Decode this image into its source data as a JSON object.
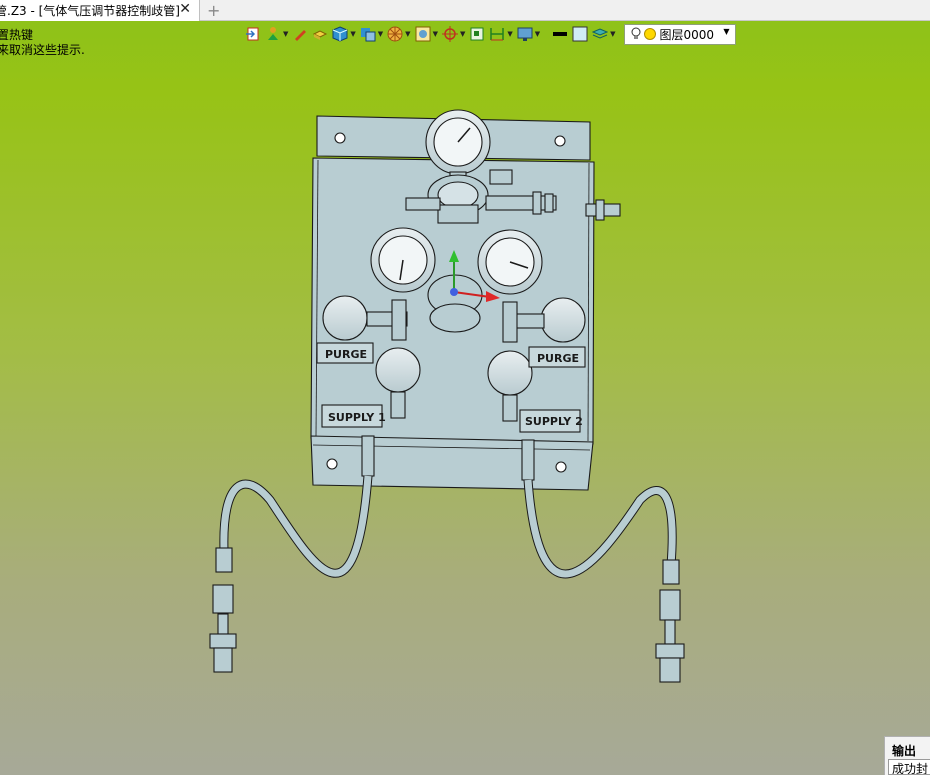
{
  "tab": {
    "title": "管.Z3 - [气体气压调节器控制歧管]",
    "close_glyph": "✕",
    "add_glyph": "+"
  },
  "hints": {
    "line1": "置热键",
    "line2": "来取消这些提示."
  },
  "toolbar": {
    "buttons": [
      {
        "icon": "import-icon",
        "dropdown": false
      },
      {
        "icon": "layer-person-icon",
        "dropdown": true
      },
      {
        "icon": "pen-icon",
        "dropdown": false
      },
      {
        "icon": "box-pencil-icon",
        "dropdown": false
      },
      {
        "icon": "cube-icon",
        "dropdown": true
      },
      {
        "icon": "copy-icon",
        "dropdown": true
      },
      {
        "icon": "view-wheel-icon",
        "dropdown": true
      },
      {
        "icon": "frame-icon",
        "dropdown": true
      },
      {
        "icon": "target-icon",
        "dropdown": true
      },
      {
        "icon": "fit-view-icon",
        "dropdown": false
      },
      {
        "icon": "dimension-icon",
        "dropdown": true
      },
      {
        "icon": "display-mode-icon",
        "dropdown": true
      },
      {
        "icon": "line-color-icon",
        "dropdown": false
      },
      {
        "icon": "fill-color-icon",
        "dropdown": false
      },
      {
        "icon": "layer-stack-icon",
        "dropdown": true
      }
    ],
    "layer_value": "图层0000",
    "dropdown_glyph": "▼"
  },
  "model_labels": {
    "purge_left": "PURGE",
    "purge_right": "PURGE",
    "supply_1": "SUPPLY 1",
    "supply_2": "SUPPLY 2"
  },
  "output": {
    "title": "输出",
    "line": "成功封"
  },
  "colors": {
    "part_fill": "#b8cdd2",
    "part_stroke": "#1a1a1a",
    "bg_top": "#8cc21a",
    "bg_bottom": "#a7a998"
  }
}
